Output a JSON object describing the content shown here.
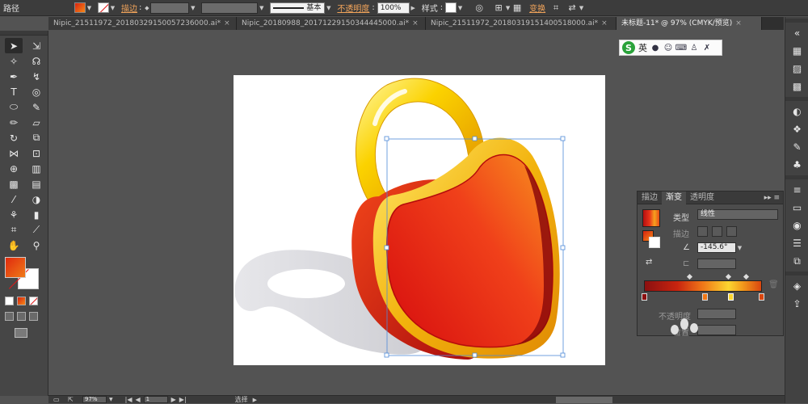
{
  "control_bar": {
    "selection_type": "路径",
    "stroke_label": "描边",
    "brush_label": "基本",
    "opacity_label": "不透明度",
    "opacity_value": "100%",
    "style_label": "样式",
    "transform_label": "变换"
  },
  "tabs": [
    {
      "label": "Nipic_21511972_20180329150057236000.ai*",
      "close": "×"
    },
    {
      "label": "Nipic_20180988_20171229150344445000.ai*",
      "close": "×"
    },
    {
      "label": "Nipic_21511972_20180319151400518000.ai*",
      "close": "×"
    },
    {
      "label": "未标题-11* @ 97% (CMYK/预览)",
      "close": "×"
    }
  ],
  "ime": {
    "logo": "S",
    "lang": "英"
  },
  "gradient_panel": {
    "tabs": [
      "描边",
      "渐变",
      "透明度"
    ],
    "type_label": "类型",
    "type_value": "线性",
    "stroke_label": "描边",
    "angle_value": "-145.6°",
    "opacity_label": "不透明度",
    "location_label": "位置"
  },
  "status_bar": {
    "zoom": "97%",
    "page": "1",
    "tool_name": "选择"
  },
  "colors": {
    "gradient_stops": [
      "#8c1010",
      "#c8240f",
      "#f07818",
      "#fbd530",
      "#d9460f"
    ],
    "accent_orange": "#f0a35a"
  }
}
